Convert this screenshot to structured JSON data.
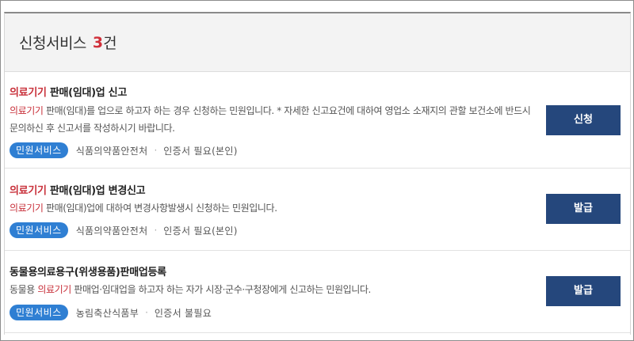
{
  "header": {
    "title": "신청서비스",
    "count": "3",
    "unit": "건"
  },
  "items": [
    {
      "title_highlight": "의료기기",
      "title_rest": " 판매(임대)업 신고",
      "desc_highlight": "의료기기",
      "desc_rest": " 판매(임대)를 업으로 하고자 하는 경우 신청하는 민원입니다. * 자세한 신고요건에 대하여 영업소 소재지의 관할 보건소에 반드시 문의하신 후 신고서를 작성하시기 바랍니다.",
      "badge": "민원서비스",
      "org": "식품의약품안전처",
      "cert": "인증서 필요(본인)",
      "action": "신청"
    },
    {
      "title_highlight": "의료기기",
      "title_rest": " 판매(임대)업 변경신고",
      "desc_highlight": "의료기기",
      "desc_rest": " 판매(임대)업에 대하여 변경사항발생시 신청하는 민원입니다.",
      "badge": "민원서비스",
      "org": "식품의약품안전처",
      "cert": "인증서 필요(본인)",
      "action": "발급"
    },
    {
      "title_prefix": "동물용의료용구(위생용품)판매업등록",
      "desc_prefix": "동물용 ",
      "desc_highlight": "의료기기",
      "desc_rest": " 판매업·임대업을 하고자 하는 자가 시장·군수·구청장에게 신고하는 민원입니다.",
      "badge": "민원서비스",
      "org": "농림축산식품부",
      "cert": "인증서 불필요",
      "action": "발급"
    }
  ],
  "colors": {
    "highlight": "#c8303a",
    "badge": "#2f7fd3",
    "button": "#25477c"
  }
}
